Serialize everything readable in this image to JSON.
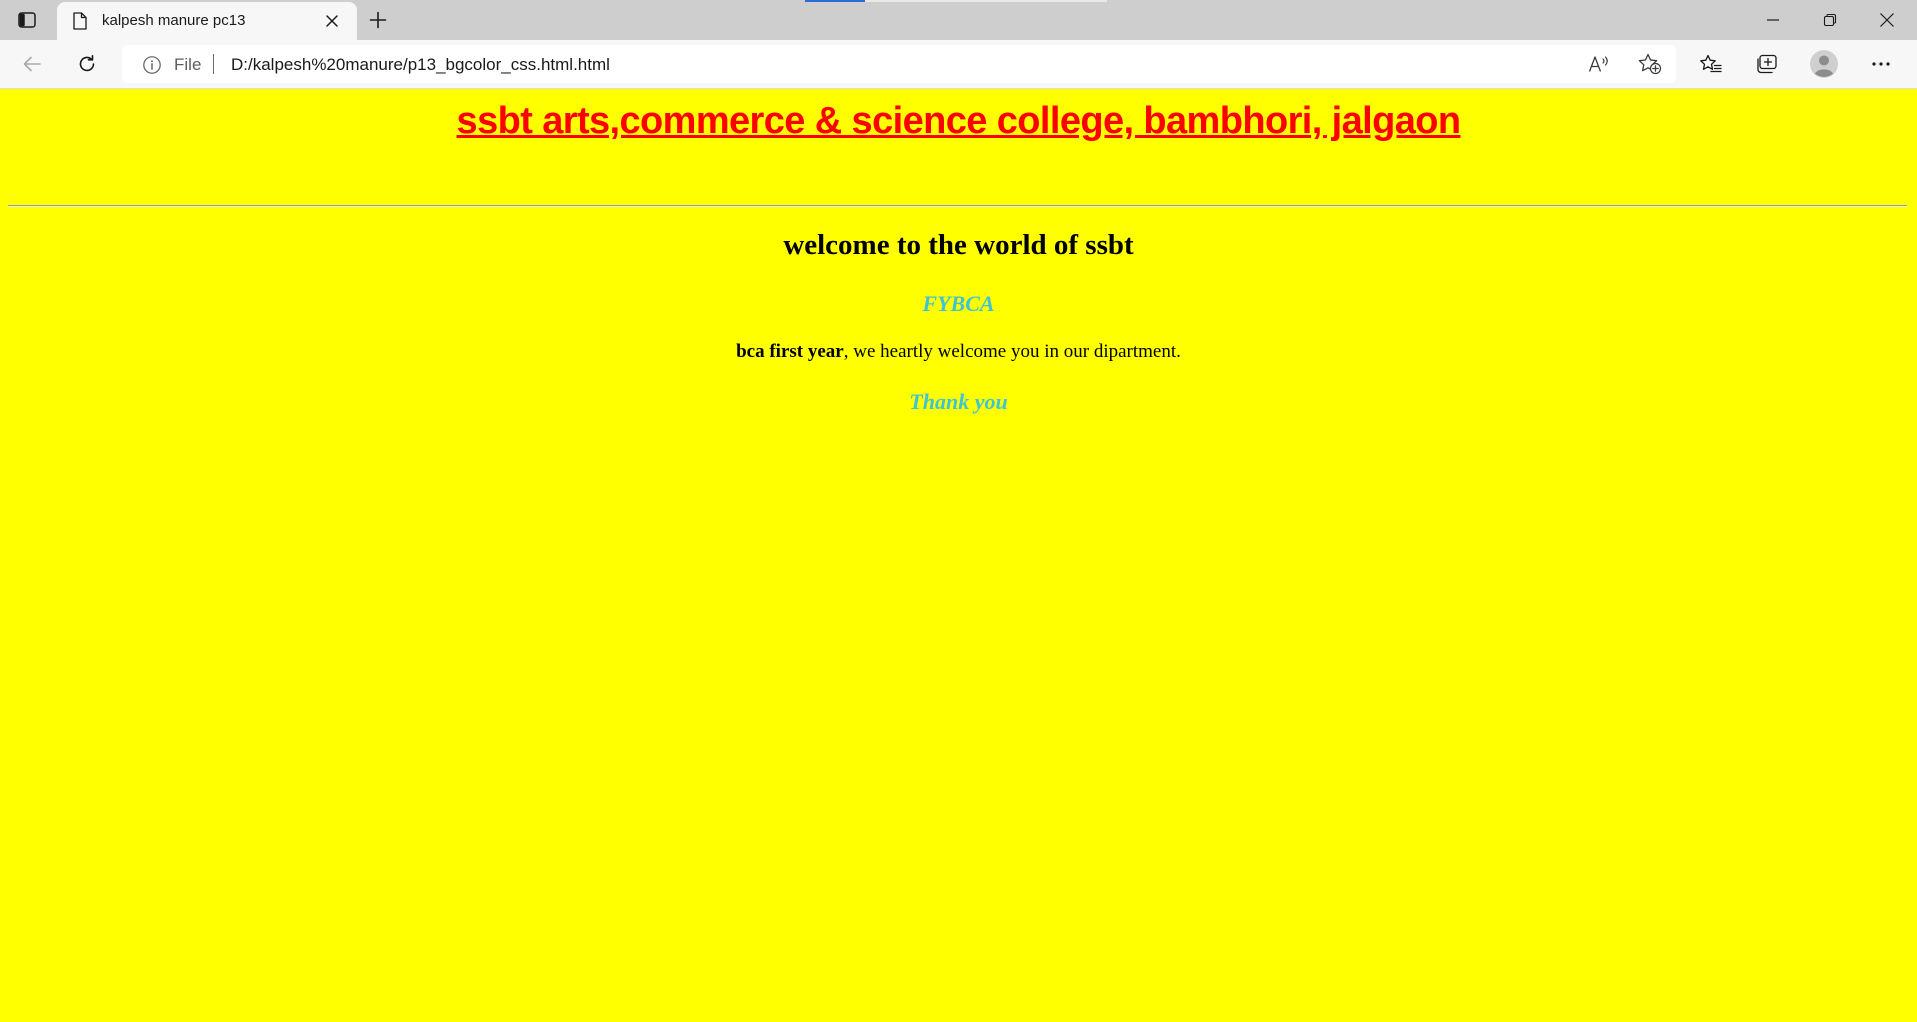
{
  "browser": {
    "tab": {
      "title": "kalpesh manure pc13",
      "favicon": "page-icon",
      "close_icon": "close-icon"
    },
    "new_tab_icon": "plus-icon",
    "address_bar": {
      "scheme_label": "File",
      "url": "D:/kalpesh%20manure/p13_bgcolor_css.html.html",
      "info_icon": "info-icon"
    },
    "toolbar_icons": [
      "back-icon",
      "reload-icon",
      "read-aloud-icon",
      "add-favorite-icon",
      "favorites-icon",
      "collections-icon",
      "profile-icon",
      "more-icon"
    ],
    "window_controls": [
      "minimize-icon",
      "restore-icon",
      "close-icon"
    ]
  },
  "page": {
    "background_color": "#ffff00",
    "heading": "ssbt arts,commerce & science college, bambhori, jalgaon",
    "heading_color": "#ff0000",
    "welcome": "welcome to the world of ssbt",
    "class_name": "FYBCA",
    "accent_color": "#40c4d4",
    "line_bold": "bca first year",
    "line_rest": ", we heartly welcome you in our dipartment.",
    "thanks": "Thank you"
  }
}
